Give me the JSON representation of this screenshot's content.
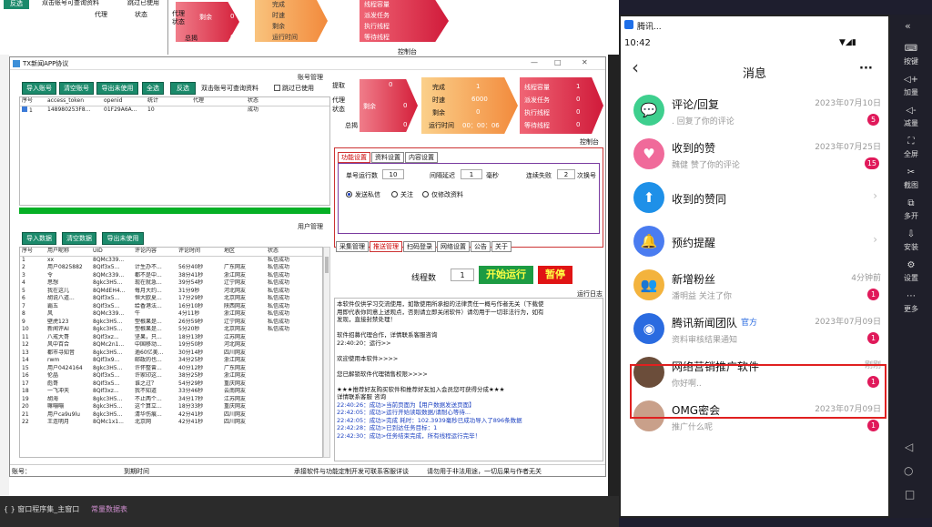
{
  "bg": {
    "top_buttons": [
      "反选",
      "双击账号可查询资料",
      "跳过已使用"
    ],
    "col_headers": [
      "代理",
      "状态"
    ],
    "dash": {
      "left": [
        "代理",
        "状态",
        "剩余",
        "总揭"
      ],
      "mid_label": "剩余",
      "mid_val": "0",
      "keys": [
        "完成",
        "时速",
        "剩余",
        "运行时间"
      ],
      "right": [
        "线程容量",
        "派发任务",
        "执行线程",
        "等待线程"
      ],
      "right_vals": [
        "0",
        "0",
        "0",
        "0"
      ],
      "zero": "0"
    },
    "ctl": "控制台"
  },
  "taskbar": {
    "left": "{ } 窗口程序集_主窗口",
    "right": "常量数据表"
  },
  "win": {
    "title": "TX新闻APP协议",
    "controls": [
      "—",
      "□",
      "✕"
    ],
    "acct_label": "账号管理",
    "acct_btns": [
      "导入账号",
      "清空账号",
      "导出未使用",
      "全选",
      "反选"
    ],
    "acct_hint": "双击账号可查询资料",
    "skip_used": "跳过已使用",
    "acct_cols": [
      "序号",
      "access_token",
      "openid",
      "统计",
      "代理",
      "状态"
    ],
    "acct_row": [
      "1",
      "148980253F8...",
      "01F29A6A...",
      "10",
      "",
      "成功"
    ],
    "user_label": "用户管理",
    "user_btns": [
      "导入数据",
      "清空数据",
      "导出未使用"
    ],
    "user_cols": [
      "序号",
      "用户昵称",
      "UID",
      "评论内容",
      "评论时间",
      "地区",
      "状态"
    ],
    "user_rows": [
      [
        "1",
        "xx",
        "8QMc339...",
        "",
        "",
        "",
        "私信成功"
      ],
      [
        "2",
        "用户0825882",
        "8QIf3x5...",
        "计生办不...",
        "56分40秒",
        "广东网友",
        "私信成功"
      ],
      [
        "3",
        "令",
        "8QMc339...",
        "都不是中...",
        "38分41秒",
        "浙江网友",
        "私信成功"
      ],
      [
        "4",
        "思想",
        "8gkc3H5...",
        "现在就急...",
        "39分54秒",
        "辽宁网友",
        "私信成功"
      ],
      [
        "5",
        "我在这儿",
        "8QMdEH4...",
        "每月大约...",
        "31分9秒",
        "河北网友",
        "私信成功"
      ],
      [
        "6",
        "胡说八道...",
        "8QIf3x5...",
        "恒大欧夏...",
        "17分29秒",
        "北京网友",
        "私信成功"
      ],
      [
        "7",
        "霸五",
        "8QIf3x5...",
        "给香港法...",
        "16分10秒",
        "陕西网友",
        "私信成功"
      ],
      [
        "8",
        "风",
        "8QMc339...",
        "牛",
        "4分11秒",
        "浙江网友",
        "私信成功"
      ],
      [
        "9",
        "壁虎123",
        "8gkc3H5...",
        "塑根果是...",
        "26分59秒",
        "辽宁网友",
        "私信成功"
      ],
      [
        "10",
        "新闻评AI",
        "8gkc3H5...",
        "塑根果是...",
        "5分20秒",
        "北京网友",
        "私信成功"
      ],
      [
        "11",
        "八戒大哥",
        "8QIf3xz...",
        "坚果，只...",
        "18分13秒",
        "江苏网友",
        ""
      ],
      [
        "12",
        "风中百合",
        "8QMc2n1...",
        "中国移动...",
        "19分50秒",
        "河北网友",
        ""
      ],
      [
        "13",
        "都市寻知音",
        "8gkc3H5...",
        "逾60亿美...",
        "30分14秒",
        "四川网友",
        ""
      ],
      [
        "14",
        "rwm",
        "8QIf3x9...",
        "邮政的也...",
        "34分25秒",
        "浙江网友",
        ""
      ],
      [
        "15",
        "用户0424164",
        "8gkc3H5...",
        "许怀整曾...",
        "40分12秒",
        "广东网友",
        ""
      ],
      [
        "16",
        "伦晶",
        "8QIf3x5...",
        "许家印这...",
        "38分25秒",
        "浙江网友",
        ""
      ],
      [
        "17",
        "彪哥",
        "8QIf3x5...",
        "谁之过？",
        "54分29秒",
        "重庆网友",
        ""
      ],
      [
        "18",
        "一飞冲天",
        "8QIf3xz...",
        "我不知道",
        "33分46秒",
        "云南网友",
        ""
      ],
      [
        "19",
        "胡海",
        "8gkc3H5...",
        "不止两个...",
        "34分17秒",
        "江苏网友",
        ""
      ],
      [
        "20",
        "嘛嘣嘣",
        "8gkc3H5...",
        "这个算立...",
        "18分33秒",
        "重庆网友",
        ""
      ],
      [
        "21",
        "用户ca9u9lu",
        "8gkc3H5...",
        "清华伤痕...",
        "42分41秒",
        "四川网友",
        ""
      ],
      [
        "22",
        "王连明月",
        "8QMc1x1...",
        "北京网",
        "42分41秒",
        "四川网友",
        ""
      ]
    ],
    "dash": {
      "left": [
        "提取",
        "代理状态",
        "剩余",
        "总揭"
      ],
      "left_vals": [
        "0",
        "0",
        "0"
      ],
      "mid_keys": [
        "完成",
        "时速",
        "剩余",
        "运行时间"
      ],
      "mid_vals": [
        "1",
        "6000",
        "0",
        "00：00：06"
      ],
      "right_keys": [
        "线程容量",
        "派发任务",
        "执行线程",
        "等待线程"
      ],
      "right_vals": [
        "1",
        "0",
        "0",
        "0"
      ]
    },
    "ctl": "控制台",
    "tabs_top": [
      "功能设置",
      "资料设置",
      "内容设置"
    ],
    "opt": {
      "l1": "单号运行数",
      "v1": "10",
      "l2": "间隔延迟",
      "v2": "1",
      "u2": "毫秒",
      "l3": "连续失败",
      "v3": "2",
      "u3": "次换号"
    },
    "radios": [
      "发送私信",
      "关注",
      "仅修改资料"
    ],
    "tabs_bottom": [
      "采集管理",
      "推送管理",
      "扫码登录",
      "网络设置",
      "公告",
      "关于"
    ],
    "thread_label": "线程数",
    "thread_val": "1",
    "start": "开始运行",
    "pause": "暂停",
    "log_label": "运行日志",
    "log": [
      {
        "t": "本软件仅供学习交流使用，如散使用所承担的法律责任一概与作者无关（下载使",
        "c": ""
      },
      {
        "t": "用即代表你同意上述观点，否则请立即关闭软件）请勿用于一切非法行为，如有",
        "c": ""
      },
      {
        "t": "发现，直接封禁处理！",
        "c": ""
      },
      {
        "t": "",
        "c": ""
      },
      {
        "t": "软件招募代理合作，详情联系客服咨询",
        "c": ""
      },
      {
        "t": "22:40:20：运行>>",
        "c": ""
      },
      {
        "t": "",
        "c": ""
      },
      {
        "t": "            欢迎使用本软件>>>>",
        "c": ""
      },
      {
        "t": "",
        "c": ""
      },
      {
        "t": "        您已解锁软件代理销售权限>>>>",
        "c": ""
      },
      {
        "t": "",
        "c": ""
      },
      {
        "t": "★★★推荐好友购买软件和推荐好友加入会员您可获得分成★★★",
        "c": ""
      },
      {
        "t": "详情联系客服  咨询",
        "c": ""
      },
      {
        "t": "22:40:26：成功>当前页面为【用户数据发送页面】",
        "c": "blue"
      },
      {
        "t": "22:42:05：成功>运行开始读取数据/请耐心等待...",
        "c": "blue"
      },
      {
        "t": "22:42:05：成功>完成 耗时：102.3939毫秒已成功导入了896条数据",
        "c": "blue"
      },
      {
        "t": "22:42:28：成功>已到达任务目标：1",
        "c": "blue"
      },
      {
        "t": "22:42:30：成功>任务结束完成，所有线程运行完毕！",
        "c": "blue"
      }
    ],
    "status": [
      "账号：",
      "到期时间",
      "承接软件与功能定制开发可联系客服详谈",
      "请勿用于非法用途，一切后果与作者无关"
    ]
  },
  "phone": {
    "app_title": "腾讯...",
    "time": "10:42",
    "page_title": "消息",
    "more": "···",
    "back": "‹",
    "items": [
      {
        "title": "评论/回复",
        "sub": ". 回复了你的评论",
        "date": "2023年07月10日",
        "badge": "5",
        "color": "#3ecf8e",
        "icon": "💬"
      },
      {
        "title": "收到的赞",
        "sub": "魏健  赞了你的评论",
        "date": "2023年07月25日",
        "badge": "15",
        "color": "#f06a9a",
        "icon": "♥"
      },
      {
        "title": "收到的赞同",
        "sub": "",
        "date": "",
        "badge": "",
        "color": "#1e90e8",
        "icon": "⬆"
      },
      {
        "title": "预约提醒",
        "sub": "",
        "date": "",
        "badge": "",
        "color": "#4a7cf0",
        "icon": "🔔"
      },
      {
        "title": "新增粉丝",
        "sub": "潘明益 关注了你",
        "date": "4分钟前",
        "badge": "1",
        "color": "#f3b33d",
        "icon": "👥"
      },
      {
        "title": "腾讯新闻团队",
        "tag": "官方",
        "sub": "资料审核结果通知",
        "date": "2023年07月09日",
        "badge": "1",
        "color": "#2a6be0",
        "icon": "◉"
      },
      {
        "title": "网络营销推广软件",
        "sub": "你好啊..",
        "date": "刚刚",
        "badge": "1",
        "color": "#6b4d3a",
        "icon": ""
      },
      {
        "title": "OMG密会",
        "sub": "推广什么呢",
        "date": "2023年07月09日",
        "badge": "1",
        "color": "#c9a08a",
        "icon": ""
      }
    ],
    "sidebar": [
      "按键",
      "加量",
      "减量",
      "全屏",
      "截图",
      "多开",
      "安装",
      "设置",
      "更多"
    ],
    "sidebar_icons": [
      "keyboard-icon",
      "volume-up-icon",
      "volume-down-icon",
      "fullscreen-icon",
      "scissors-icon",
      "multi-window-icon",
      "install-icon",
      "settings-icon",
      "more-icon"
    ],
    "top_arrow": "«"
  }
}
